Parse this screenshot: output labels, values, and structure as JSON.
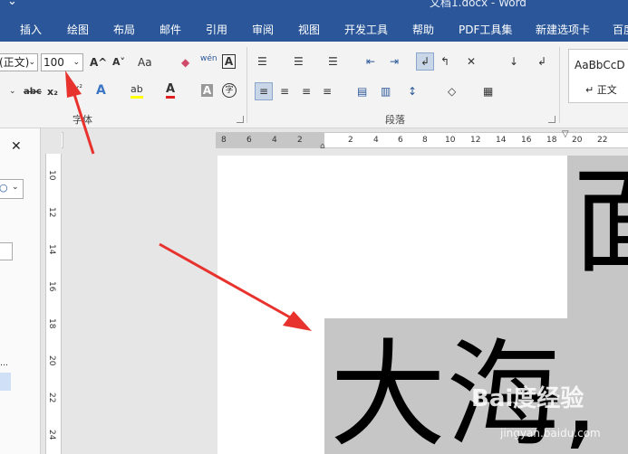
{
  "title_bar": {
    "document": "文档1.docx - Word"
  },
  "tabs": [
    "插入",
    "绘图",
    "布局",
    "邮件",
    "引用",
    "审阅",
    "视图",
    "开发工具",
    "帮助",
    "PDF工具集",
    "新建选项卡",
    "百度"
  ],
  "ribbon": {
    "font_name": "(正文)",
    "font_size": "100",
    "font_group_label": "字体",
    "paragraph_group_label": "段落",
    "style_preview": "AaBbCcD",
    "style_name": "↵ 正文",
    "icons": {
      "grow_font": "A^",
      "shrink_font": "A˅",
      "change_case": "Aa",
      "clear_format": "eraser-icon",
      "phonetic": "wén",
      "char_border": "A",
      "strike": "abc",
      "subscript": "x₂",
      "superscript": "x²",
      "text_effect": "A",
      "highlight": "ab",
      "font_color": "A",
      "char_shading": "A",
      "enclose": "字"
    }
  },
  "ruler": {
    "h_ticks": [
      "8",
      "6",
      "4",
      "2",
      "2",
      "4",
      "6",
      "8",
      "10",
      "12",
      "14",
      "16",
      "18",
      "20",
      "22"
    ],
    "v_ticks": [
      "10",
      "12",
      "14",
      "16",
      "18",
      "20",
      "22",
      "24"
    ]
  },
  "document": {
    "line1": "面",
    "line2": "大海,"
  },
  "watermark": {
    "logo": "Bai度经验",
    "url": "jingyan.baidu.com"
  },
  "colors": {
    "accent": "#2b579a",
    "selection": "#c6c6c6",
    "arrow": "#e8322d"
  }
}
